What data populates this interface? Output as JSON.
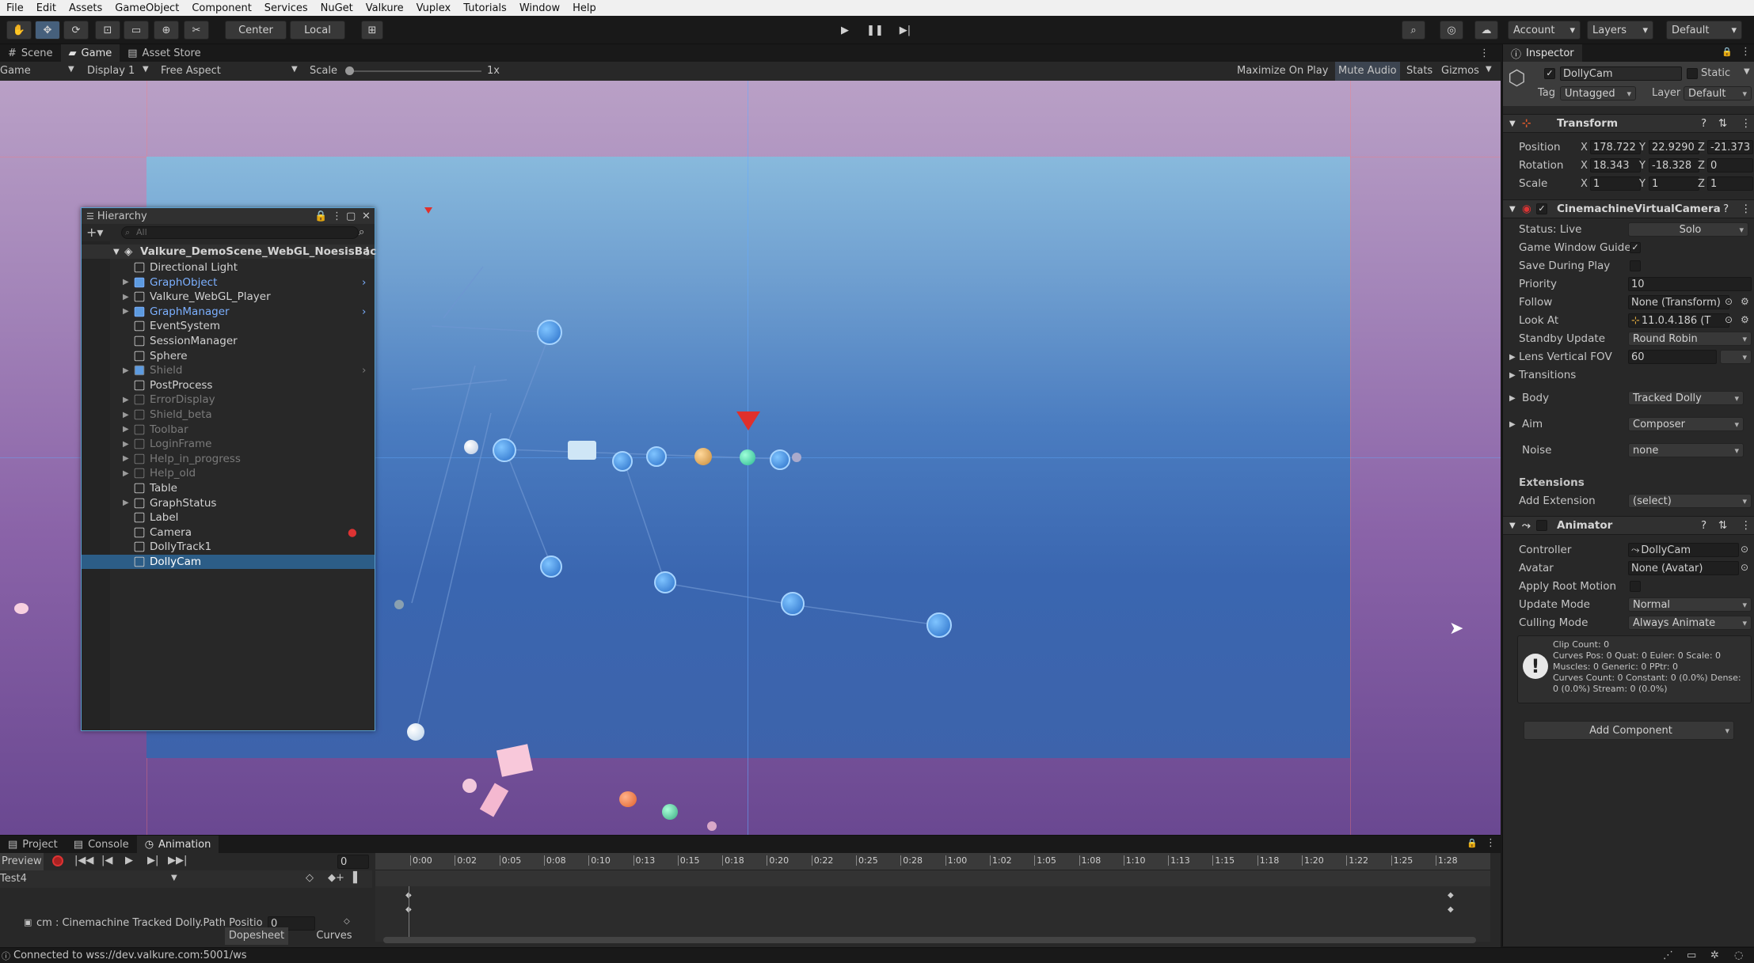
{
  "menubar": [
    "File",
    "Edit",
    "Assets",
    "GameObject",
    "Component",
    "Services",
    "NuGet",
    "Valkure",
    "Vuplex",
    "Tutorials",
    "Window",
    "Help"
  ],
  "toolbar": {
    "pivot_center": "Center",
    "pivot_local": "Local",
    "account": "Account",
    "layers": "Layers",
    "layout": "Default"
  },
  "view_tabs": {
    "scene": "Scene",
    "game": "Game",
    "asset_store": "Asset Store"
  },
  "game_bar": {
    "mode": "Game",
    "display": "Display 1",
    "aspect": "Free Aspect",
    "scale_label": "Scale",
    "scale_value": "1x",
    "maximize": "Maximize On Play",
    "mute": "Mute Audio",
    "stats": "Stats",
    "gizmos": "Gizmos"
  },
  "hierarchy": {
    "title": "Hierarchy",
    "search_placeholder": "All",
    "scene_name": "Valkure_DemoScene_WebGL_NoesisBac",
    "items": [
      {
        "label": "Directional Light",
        "style": "normal"
      },
      {
        "label": "GraphObject",
        "style": "prefab"
      },
      {
        "label": "Valkure_WebGL_Player",
        "style": "normal"
      },
      {
        "label": "GraphManager",
        "style": "prefab"
      },
      {
        "label": "EventSystem",
        "style": "normal"
      },
      {
        "label": "SessionManager",
        "style": "normal"
      },
      {
        "label": "Sphere",
        "style": "normal"
      },
      {
        "label": "Shield",
        "style": "prefab-dim"
      },
      {
        "label": "PostProcess",
        "style": "normal"
      },
      {
        "label": "ErrorDisplay",
        "style": "dim"
      },
      {
        "label": "Shield_beta",
        "style": "dim"
      },
      {
        "label": "Toolbar",
        "style": "dim"
      },
      {
        "label": "LoginFrame",
        "style": "dim"
      },
      {
        "label": "Help_in_progress",
        "style": "dim"
      },
      {
        "label": "Help_old",
        "style": "dim"
      },
      {
        "label": "Table",
        "style": "normal"
      },
      {
        "label": "GraphStatus",
        "style": "normal"
      },
      {
        "label": "Label",
        "style": "normal"
      },
      {
        "label": "Camera",
        "style": "normal"
      },
      {
        "label": "DollyTrack1",
        "style": "normal"
      },
      {
        "label": "DollyCam",
        "style": "selected"
      }
    ]
  },
  "inspector": {
    "tab": "Inspector",
    "object_name": "DollyCam",
    "static_label": "Static",
    "tag_label": "Tag",
    "tag_value": "Untagged",
    "layer_label": "Layer",
    "layer_value": "Default",
    "transform": {
      "title": "Transform",
      "position_label": "Position",
      "pos_x": "178.722",
      "pos_y": "22.9290",
      "pos_z": "-21.373",
      "rotation_label": "Rotation",
      "rot_x": "18.343",
      "rot_y": "-18.328",
      "rot_z": "0",
      "scale_label": "Scale",
      "scl_x": "1",
      "scl_y": "1",
      "scl_z": "1"
    },
    "vcam": {
      "title": "CinemachineVirtualCamera",
      "status_label": "Status: Live",
      "solo": "Solo",
      "guides_label": "Game Window Guides",
      "save_label": "Save During Play",
      "priority_label": "Priority",
      "priority": "10",
      "follow_label": "Follow",
      "follow": "None (Transform)",
      "lookat_label": "Look At",
      "lookat": "11.0.4.186 (T",
      "standby_label": "Standby Update",
      "standby": "Round Robin",
      "fov_label": "Lens Vertical FOV",
      "fov": "60",
      "transitions": "Transitions",
      "body_label": "Body",
      "body": "Tracked Dolly",
      "aim_label": "Aim",
      "aim": "Composer",
      "noise_label": "Noise",
      "noise": "none",
      "extensions": "Extensions",
      "addext_label": "Add Extension",
      "addext": "(select)"
    },
    "animator": {
      "title": "Animator",
      "controller_label": "Controller",
      "controller": "DollyCam",
      "avatar_label": "Avatar",
      "avatar": "None (Avatar)",
      "rootmotion_label": "Apply Root Motion",
      "update_label": "Update Mode",
      "update": "Normal",
      "culling_label": "Culling Mode",
      "culling": "Always Animate",
      "info": [
        "Clip Count: 0",
        "Curves Pos: 0 Quat: 0 Euler: 0 Scale: 0",
        "Muscles: 0 Generic: 0 PPtr: 0",
        "Curves Count: 0 Constant: 0 (0.0%) Dense:",
        "0 (0.0%) Stream: 0 (0.0%)"
      ]
    },
    "add_component": "Add Component"
  },
  "bottom_tabs": {
    "project": "Project",
    "console": "Console",
    "animation": "Animation"
  },
  "animation": {
    "preview": "Preview",
    "frame": "0",
    "clip": "Test4",
    "property": "cm : Cinemachine Tracked Dolly.Path Positio",
    "property_value": "0",
    "dopesheet": "Dopesheet",
    "curves": "Curves",
    "ticks": [
      "0:00",
      "0:02",
      "0:05",
      "0:08",
      "0:10",
      "0:13",
      "0:15",
      "0:18",
      "0:20",
      "0:22",
      "0:25",
      "0:28",
      "1:00",
      "1:02",
      "1:05",
      "1:08",
      "1:10",
      "1:13",
      "1:15",
      "1:18",
      "1:20",
      "1:22",
      "1:25",
      "1:28"
    ]
  },
  "status": "Connected to wss://dev.valkure.com:5001/ws"
}
